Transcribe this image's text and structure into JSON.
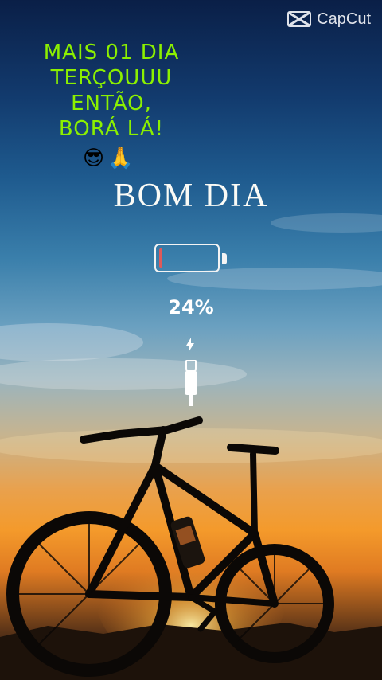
{
  "watermark": {
    "label": "CapCut",
    "icon": "capcut-logo-icon"
  },
  "caption": {
    "lines": [
      "MAIS 01 DIA",
      "TERÇOUUU",
      "ENTÃO,",
      "BORÁ LÁ!"
    ],
    "emojis": "😎🙏",
    "color": "#8cf000"
  },
  "headline": "BOM DIA",
  "battery": {
    "level": 0.05,
    "percent_text": "24%",
    "fill_color": "#e05a5a",
    "icons": [
      "battery-icon",
      "lightning-bolt-icon",
      "charging-cable-icon"
    ]
  },
  "scene": {
    "subject": "mountain-bike-silhouette",
    "background": "sunset-sky"
  }
}
